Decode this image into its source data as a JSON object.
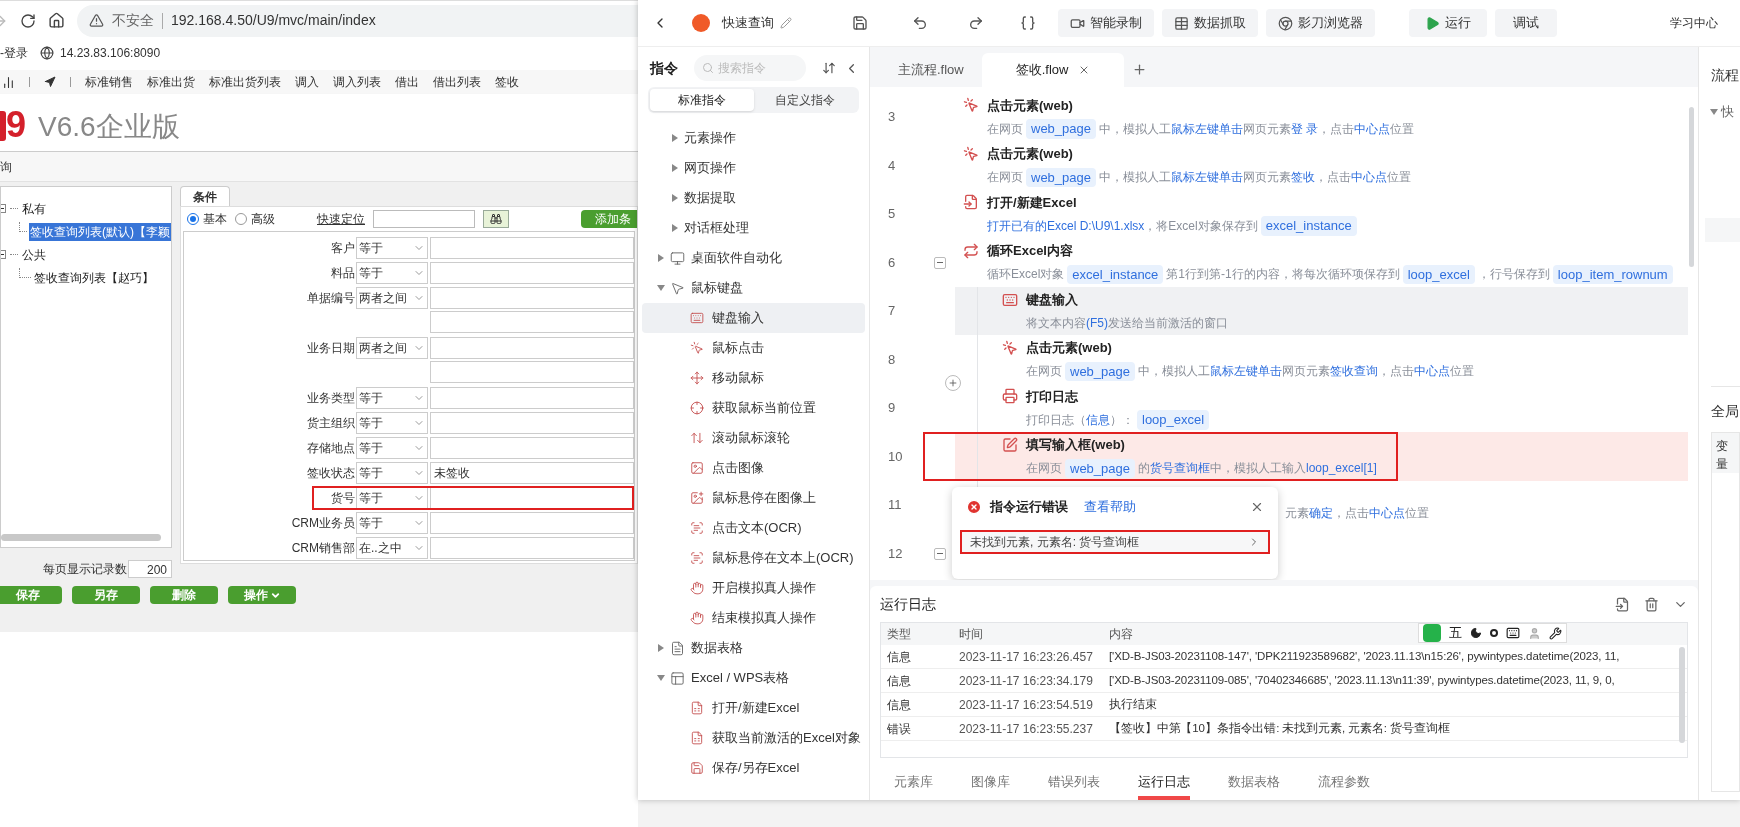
{
  "browser": {
    "security_label": "不安全",
    "url": "192.168.4.50/U9/mvc/main/index",
    "bookmarks": [
      {
        "label": "-登录",
        "kind": "text"
      },
      {
        "label": "14.23.83.106:8090",
        "kind": "site"
      }
    ],
    "menu_items": [
      "标准销售",
      "标准出货",
      "标准出货列表",
      "调入",
      "调入列表",
      "借出",
      "借出列表",
      "签收"
    ],
    "product": {
      "logo": "9",
      "edition": "V6.6企业版"
    },
    "dialog": {
      "title": "询",
      "tree": [
        {
          "label": "私有",
          "expanded": true,
          "children": [
            {
              "label": "签收查询列表(默认)【李颖",
              "selected": true
            }
          ]
        },
        {
          "label": "公共",
          "expanded": true,
          "children": [
            {
              "label": "签收查询列表【赵巧】",
              "selected": false
            }
          ]
        }
      ],
      "tab": "条件",
      "modes": [
        {
          "label": "基本",
          "selected": true
        },
        {
          "label": "高级",
          "selected": false
        }
      ],
      "quick_locate": "快速定位",
      "add_button": "添加条",
      "conditions": [
        {
          "label": "客户",
          "operator": "等于",
          "kind": "single",
          "highlighted": false
        },
        {
          "label": "料品",
          "operator": "等于",
          "kind": "single",
          "highlighted": false
        },
        {
          "label": "单据编号",
          "operator": "两者之间",
          "kind": "range",
          "highlighted": false
        },
        {
          "label": "业务日期",
          "operator": "两者之间",
          "kind": "range",
          "highlighted": false
        },
        {
          "label": "业务类型",
          "operator": "等于",
          "kind": "single",
          "highlighted": false
        },
        {
          "label": "货主组织",
          "operator": "等于",
          "kind": "single",
          "highlighted": false
        },
        {
          "label": "存储地点",
          "operator": "等于",
          "kind": "single",
          "highlighted": false
        },
        {
          "label": "签收状态",
          "operator": "等于",
          "kind": "single",
          "value": "未签收",
          "highlighted": false
        },
        {
          "label": "货号",
          "operator": "等于",
          "kind": "single",
          "highlighted": true
        },
        {
          "label": "CRM业务员",
          "operator": "等于",
          "kind": "single",
          "highlighted": false
        },
        {
          "label": "CRM销售部",
          "operator": "在..之中",
          "kind": "single",
          "highlighted": false
        }
      ],
      "page_size_label": "每页显示记录数",
      "page_size": "200",
      "buttons": [
        {
          "label": "保存",
          "kind": "plain"
        },
        {
          "label": "另存",
          "kind": "plain"
        },
        {
          "label": "删除",
          "kind": "plain"
        },
        {
          "label": "操作",
          "kind": "menu"
        }
      ]
    }
  },
  "app": {
    "title": "快速查询",
    "toolbar": [
      {
        "label": "智能录制",
        "kind": "record"
      },
      {
        "label": "数据抓取",
        "kind": "grab"
      },
      {
        "label": "影刀浏览器",
        "kind": "browser"
      },
      {
        "label": "运行",
        "kind": "run"
      },
      {
        "label": "调试",
        "kind": "debug"
      }
    ],
    "learn": "学习中心",
    "sidebar": {
      "title": "指令",
      "search_placeholder": "搜索指令",
      "segments": [
        {
          "label": "标准指令",
          "selected": true
        },
        {
          "label": "自定义指令",
          "selected": false
        }
      ],
      "items": [
        {
          "expanded": true,
          "children": [
            {
              "label": "元素操作",
              "expanded": false,
              "selected": false
            },
            {
              "label": "网页操作",
              "expanded": false,
              "selected": false
            },
            {
              "label": "数据提取",
              "expanded": false,
              "selected": false
            },
            {
              "label": "对话框处理",
              "expanded": false,
              "selected": false
            }
          ]
        },
        {
          "label": "桌面软件自动化",
          "expanded": false,
          "selected": false
        },
        {
          "label": "鼠标键盘",
          "expanded": true,
          "selected": false,
          "children": [
            {
              "label": "键盘输入",
              "selected": true
            },
            {
              "label": "鼠标点击",
              "selected": false
            },
            {
              "label": "移动鼠标",
              "selected": false
            },
            {
              "label": "获取鼠标当前位置",
              "selected": false
            },
            {
              "label": "滚动鼠标滚轮",
              "selected": false
            },
            {
              "label": "点击图像",
              "selected": false
            },
            {
              "label": "鼠标悬停在图像上",
              "selected": false
            },
            {
              "label": "点击文本(OCR)",
              "selected": false
            },
            {
              "label": "鼠标悬停在文本上(OCR)",
              "selected": false
            },
            {
              "label": "开启模拟真人操作",
              "selected": false
            },
            {
              "label": "结束模拟真人操作",
              "selected": false
            }
          ]
        },
        {
          "label": "数据表格",
          "expanded": false,
          "selected": false
        },
        {
          "label": "Excel / WPS表格",
          "expanded": true,
          "selected": false,
          "children": [
            {
              "label": "打开/新建Excel",
              "selected": false
            },
            {
              "label": "获取当前激活的Excel对象",
              "selected": false
            },
            {
              "label": "保存/另存Excel",
              "selected": false
            }
          ]
        }
      ]
    },
    "tabs": [
      {
        "label": "主流程.flow",
        "selected": false
      },
      {
        "label": "签收.flow",
        "selected": true
      }
    ],
    "steps": [
      {
        "number": "3",
        "kind": "click_web",
        "title": "点击元素(web)",
        "selected": false,
        "error": false,
        "desc": [
          {
            "kind": "plain",
            "text": "在网页"
          },
          {
            "kind": "var",
            "text": "web_page"
          },
          {
            "kind": "plain",
            "text": "中，模拟人工"
          },
          {
            "kind": "key",
            "text": "鼠标左键单击"
          },
          {
            "kind": "plain",
            "text": "网页元素"
          },
          {
            "kind": "key",
            "text": "登 录"
          },
          {
            "kind": "plain",
            "text": "，点击"
          },
          {
            "kind": "key",
            "text": "中心点"
          },
          {
            "kind": "plain",
            "text": "位置"
          }
        ]
      },
      {
        "number": "4",
        "kind": "click_web",
        "title": "点击元素(web)",
        "selected": false,
        "error": false,
        "desc": [
          {
            "kind": "plain",
            "text": "在网页"
          },
          {
            "kind": "var",
            "text": "web_page"
          },
          {
            "kind": "plain",
            "text": "中，模拟人工"
          },
          {
            "kind": "key",
            "text": "鼠标左键单击"
          },
          {
            "kind": "plain",
            "text": "网页元素"
          },
          {
            "kind": "key",
            "text": "签收"
          },
          {
            "kind": "plain",
            "text": "，点击"
          },
          {
            "kind": "key",
            "text": "中心点"
          },
          {
            "kind": "plain",
            "text": "位置"
          }
        ]
      },
      {
        "number": "5",
        "kind": "open_excel",
        "title": "打开/新建Excel",
        "selected": false,
        "error": false,
        "desc": [
          {
            "kind": "key",
            "text": "打开已有的Excel D:\\U9\\1.xlsx"
          },
          {
            "kind": "plain",
            "text": "，将Excel对象保存到"
          },
          {
            "kind": "var",
            "text": "excel_instance"
          }
        ]
      },
      {
        "number": "6",
        "kind": "loop_excel",
        "title": "循环Excel内容",
        "selected": false,
        "error": false,
        "expanded": true,
        "desc": [
          {
            "kind": "plain",
            "text": "循环Excel对象"
          },
          {
            "kind": "var",
            "text": "excel_instance"
          },
          {
            "kind": "plain",
            "text": "第1行到第-1行的内容，将每次循环项保存到"
          },
          {
            "kind": "var",
            "text": "loop_excel"
          },
          {
            "kind": "plain",
            "text": "，行号保存到"
          },
          {
            "kind": "var",
            "text": "loop_item_rownum"
          }
        ],
        "children": [
          {
            "number": "7",
            "kind": "keyboard",
            "title": "键盘输入",
            "selected": true,
            "error": false,
            "desc": [
              {
                "kind": "plain",
                "text": "将文本内容"
              },
              {
                "kind": "key",
                "text": "(F5)"
              },
              {
                "kind": "plain",
                "text": "发送给当前激活的窗口"
              }
            ]
          },
          {
            "number": "8",
            "kind": "click_web",
            "title": "点击元素(web)",
            "selected": false,
            "error": false,
            "desc": [
              {
                "kind": "plain",
                "text": "在网页"
              },
              {
                "kind": "var",
                "text": "web_page"
              },
              {
                "kind": "plain",
                "text": "中，模拟人工"
              },
              {
                "kind": "key",
                "text": "鼠标左键单击"
              },
              {
                "kind": "plain",
                "text": "网页元素"
              },
              {
                "kind": "key",
                "text": "签收查询"
              },
              {
                "kind": "plain",
                "text": "，点击"
              },
              {
                "kind": "key",
                "text": "中心点"
              },
              {
                "kind": "plain",
                "text": "位置"
              }
            ]
          },
          {
            "number": "9",
            "kind": "print_log",
            "title": "打印日志",
            "selected": false,
            "error": false,
            "desc": [
              {
                "kind": "plain",
                "text": "打印日志（"
              },
              {
                "kind": "key",
                "text": "信息"
              },
              {
                "kind": "plain",
                "text": "）："
              },
              {
                "kind": "var",
                "text": "loop_excel"
              }
            ]
          },
          {
            "number": "10",
            "kind": "fill_input",
            "title": "填写输入框(web)",
            "selected": false,
            "error": true,
            "desc": [
              {
                "kind": "plain",
                "text": "在网页"
              },
              {
                "kind": "var",
                "text": "web_page"
              },
              {
                "kind": "plain",
                "text": "的"
              },
              {
                "kind": "key",
                "text": "货号查询框"
              },
              {
                "kind": "plain",
                "text": "中，模拟人工输入"
              },
              {
                "kind": "key",
                "text": "loop_excel[1]"
              }
            ]
          },
          {
            "number": "11",
            "kind": "click_web",
            "selected": false,
            "error": false,
            "desc": [
              {
                "kind": "plain",
                "text": "元素"
              },
              {
                "kind": "key",
                "text": "确定"
              },
              {
                "kind": "plain",
                "text": "，点击"
              },
              {
                "kind": "key",
                "text": "中心点"
              },
              {
                "kind": "plain",
                "text": "位置"
              }
            ]
          }
        ]
      },
      {
        "number": "12",
        "kind": "other",
        "selected": false,
        "error": false,
        "expanded": true
      }
    ],
    "error_popup": {
      "title": "指令运行错误",
      "help_link": "查看帮助",
      "message": "未找到元素, 元素名: 货号查询框"
    },
    "log": {
      "title": "运行日志",
      "columns": [
        "类型",
        "时间",
        "内容"
      ],
      "rows": [
        [
          "信息",
          "2023-11-17 16:23:26.457",
          "['XD-B-JS03-20231108-147', 'DPK211923589682', '2023.11.13\\n15:26', pywintypes.datetime(2023, 11,"
        ],
        [
          "信息",
          "2023-11-17 16:23:34.179",
          "['XD-B-JS03-20231109-085', '70402346685', '2023.11.13\\n11:39', pywintypes.datetime(2023, 11, 9, 0,"
        ],
        [
          "信息",
          "2023-11-17 16:23:54.519",
          "执行结束"
        ],
        [
          "错误",
          "2023-11-17 16:23:55.237",
          "【签收】中第【10】条指令出错: 未找到元素, 元素名: 货号查询框"
        ]
      ]
    },
    "ime_toolbar": {
      "mode": "五"
    },
    "bottom_tabs": [
      {
        "label": "元素库",
        "selected": false
      },
      {
        "label": "图像库",
        "selected": false
      },
      {
        "label": "错误列表",
        "selected": false
      },
      {
        "label": "运行日志",
        "selected": true
      },
      {
        "label": "数据表格",
        "selected": false
      },
      {
        "label": "流程参数",
        "selected": false
      }
    ],
    "right_panel": {
      "title": "流程",
      "tree_item": "快",
      "section": "全局",
      "column": "变量"
    }
  }
}
